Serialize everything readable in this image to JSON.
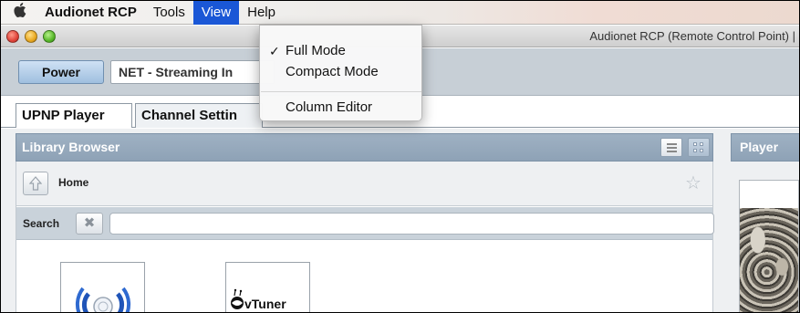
{
  "menubar": {
    "apple_icon": "apple-logo",
    "app_name": "Audionet RCP",
    "items": [
      "Tools",
      "View",
      "Help"
    ],
    "active_item": "View"
  },
  "view_menu": {
    "items": [
      {
        "label": "Full Mode",
        "checked": true
      },
      {
        "label": "Compact Mode",
        "checked": false
      },
      {
        "label": "Column Editor",
        "checked": false
      }
    ],
    "check_glyph": "✓"
  },
  "window": {
    "title": "Audionet RCP (Remote Control Point) |"
  },
  "toolbar": {
    "power_label": "Power",
    "source_value": "NET - Streaming In"
  },
  "tabs": [
    {
      "label": "UPNP Player",
      "selected": true
    },
    {
      "label": "Channel Settin",
      "selected": false
    }
  ],
  "library": {
    "header": "Library Browser",
    "nav_label": "Home",
    "search_label": "Search",
    "search_value": "",
    "tiles": [
      {
        "icon": "upnp-broadcast-icon"
      },
      {
        "icon": "vtuner-logo",
        "label": "vTuner"
      }
    ]
  },
  "player": {
    "header": "Player"
  },
  "colors": {
    "menu_highlight": "#1a57d6",
    "panel_header": "#9fb1c3",
    "toolbar_bg": "#c7cfd6"
  }
}
